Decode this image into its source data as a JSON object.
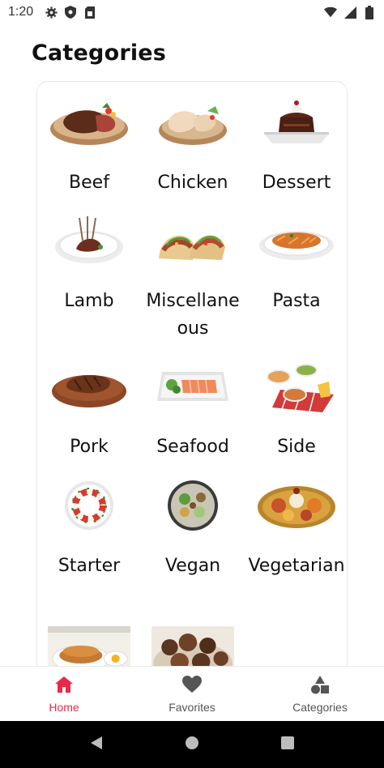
{
  "status_bar": {
    "time": "1:20",
    "left_icons": [
      "gear-icon",
      "shield-icon",
      "sim-card-icon"
    ],
    "right_icons": [
      "wifi-icon",
      "signal-icon",
      "battery-icon"
    ]
  },
  "page": {
    "title": "Categories"
  },
  "categories": [
    {
      "label": "Beef",
      "image": "beef-image"
    },
    {
      "label": "Chicken",
      "image": "chicken-image"
    },
    {
      "label": "Dessert",
      "image": "dessert-image"
    },
    {
      "label": "Lamb",
      "image": "lamb-image"
    },
    {
      "label": "Miscellaneous",
      "image": "miscellaneous-image"
    },
    {
      "label": "Pasta",
      "image": "pasta-image"
    },
    {
      "label": "Pork",
      "image": "pork-image"
    },
    {
      "label": "Seafood",
      "image": "seafood-image"
    },
    {
      "label": "Side",
      "image": "side-image"
    },
    {
      "label": "Starter",
      "image": "starter-image"
    },
    {
      "label": "Vegan",
      "image": "vegan-image"
    },
    {
      "label": "Vegetarian",
      "image": "vegetarian-image"
    },
    {
      "label": "",
      "image": "breakfast-image"
    },
    {
      "label": "",
      "image": "goat-image"
    }
  ],
  "bottom_nav": {
    "items": [
      {
        "label": "Home",
        "icon": "home-icon",
        "active": true
      },
      {
        "label": "Favorites",
        "icon": "heart-icon",
        "active": false
      },
      {
        "label": "Categories",
        "icon": "shapes-icon",
        "active": false
      }
    ]
  },
  "colors": {
    "accent": "#e8294a",
    "inactive": "#555555",
    "card_border": "#e6e6e6",
    "system_bar": "#000000"
  }
}
